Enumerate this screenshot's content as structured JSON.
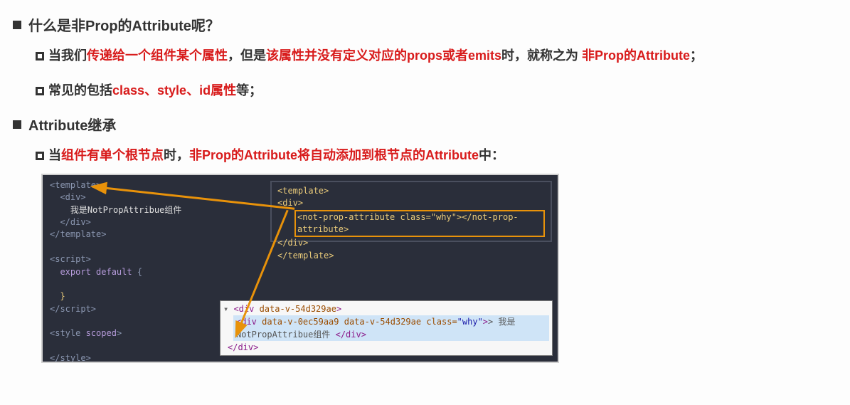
{
  "section1": {
    "title": "什么是非Prop的Attribute呢？",
    "bullets": [
      {
        "segments": [
          {
            "text": "当我们",
            "cls": "black"
          },
          {
            "text": "传递给一个组件某个属性",
            "cls": "r"
          },
          {
            "text": "，但是",
            "cls": "black"
          },
          {
            "text": "该属性并没有定义对应的props或者emits",
            "cls": "r"
          },
          {
            "text": "时，就称之为 ",
            "cls": "black"
          },
          {
            "text": "非Prop的Attribute",
            "cls": "rb"
          },
          {
            "text": "；",
            "cls": "black"
          }
        ]
      },
      {
        "segments": [
          {
            "text": "常见的包括",
            "cls": "black"
          },
          {
            "text": "class、style、id属性",
            "cls": "r"
          },
          {
            "text": "等；",
            "cls": "black"
          }
        ]
      }
    ]
  },
  "section2": {
    "title": "Attribute继承",
    "bullets": [
      {
        "segments": [
          {
            "text": "当",
            "cls": "black"
          },
          {
            "text": "组件有单个根节点",
            "cls": "r"
          },
          {
            "text": "时，",
            "cls": "black"
          },
          {
            "text": "非Prop的Attribute将自动添加到根节点的Attribute",
            "cls": "r"
          },
          {
            "text": "中：",
            "cls": "black"
          }
        ]
      }
    ]
  },
  "code": {
    "left": [
      "<template>",
      "  <div>",
      "    我是NotPropAttribue组件",
      "  </div>",
      "</template>",
      "",
      "<script>",
      "  export default {",
      "",
      "  }",
      "</script>",
      "",
      "<style scoped>",
      "",
      "</style>"
    ],
    "inset": {
      "l1": "<template>",
      "l2": "  <div>",
      "l3_inner": "<not-prop-attribute class=\"why\"></not-prop-attribute>",
      "l4": "  </div>",
      "l5": "</template>"
    },
    "devtools": {
      "l1_open": "<div",
      "l1_attr": " data-v-54d329ae",
      "l1_close": ">",
      "sel_open": "<div",
      "sel_attrs": " data-v-0ec59aa9 data-v-54d329ae class=",
      "sel_val": "\"why\"",
      "sel_mid": "> 我是NotPropAttribue组件 ",
      "sel_end": "</div>",
      "l3": "</div>"
    }
  }
}
